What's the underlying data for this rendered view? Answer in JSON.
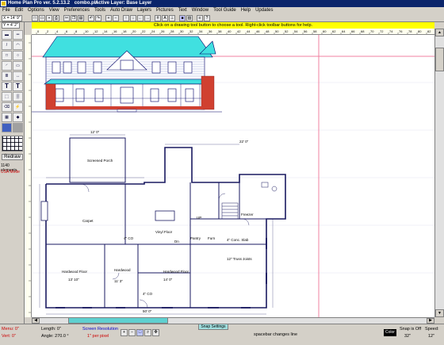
{
  "titlebar": {
    "app": "Home Plan Pro ver. 5.2.13.2",
    "file": "combo.pln",
    "layer": "Active Layer: Base Layer"
  },
  "menu": [
    "File",
    "Edit",
    "Options",
    "View",
    "Preferences",
    "Tools",
    "Auto Draw",
    "Layers",
    "Pictures",
    "Text",
    "Window",
    "Tool Guide",
    "Help",
    "Updates"
  ],
  "toolbar": {
    "x_coord": "X = 14' 9\"",
    "y_coord": "Y = 4' 2\""
  },
  "hint": "Click on a drawing tool button to choose a tool.   Right-click toolbar buttons for help.",
  "ruler_ticks": [
    "0",
    "2",
    "4",
    "6",
    "8",
    "10",
    "12",
    "14",
    "16",
    "18",
    "20",
    "22",
    "24",
    "26",
    "28",
    "30",
    "32",
    "34",
    "36",
    "38",
    "40",
    "42",
    "44",
    "46",
    "48",
    "50",
    "52",
    "54",
    "56",
    "58",
    "60",
    "62",
    "64",
    "66",
    "68",
    "70",
    "72",
    "74",
    "76",
    "78",
    "80",
    "82"
  ],
  "palette": {
    "redraw": "Redraw",
    "elements": "1140 elements",
    "mode": "USA Mode"
  },
  "plan_labels": {
    "screened_porch": "Screened Porch",
    "carpet": "Carpet",
    "vinyl_floor": "Vinyl Floor",
    "hardwood_floor_left": "Hardwood Floor",
    "hardwood": "Hardwood",
    "hardwood_floor_right": "Hardwood Floor",
    "conc_slab": "4\" Conc. Slab",
    "truss_joists": "12\" Truss Joists",
    "pantry": "Pantry",
    "dn": "Dn",
    "freezer": "Freezer",
    "co1": "4\" CO",
    "co2": "4\" CO",
    "up": "UP",
    "furn": "Furn",
    "dim_12": "12' 0\"",
    "dim_top": "22' 0\"",
    "dim_bottom": "50' 0\"",
    "dim_1310": "13' 10\"",
    "dim_113": "11' 3\"",
    "dim_140": "14' 0\""
  },
  "status": {
    "menu_x": "Menu: 0\"",
    "vert": "Vert: 0\"",
    "length": "Length:  0\"",
    "angle": "Angle: 270.0 °",
    "screen_res": "Screen Resolution",
    "per_pixel": "1\" per pixel",
    "snap_settings": "Snap Settings",
    "spacebar": "spacebar changes line",
    "color": "Color",
    "snap": "Snap is Off",
    "snap_val": "32\"",
    "speed": "Speed:",
    "speed_val": "12\""
  }
}
